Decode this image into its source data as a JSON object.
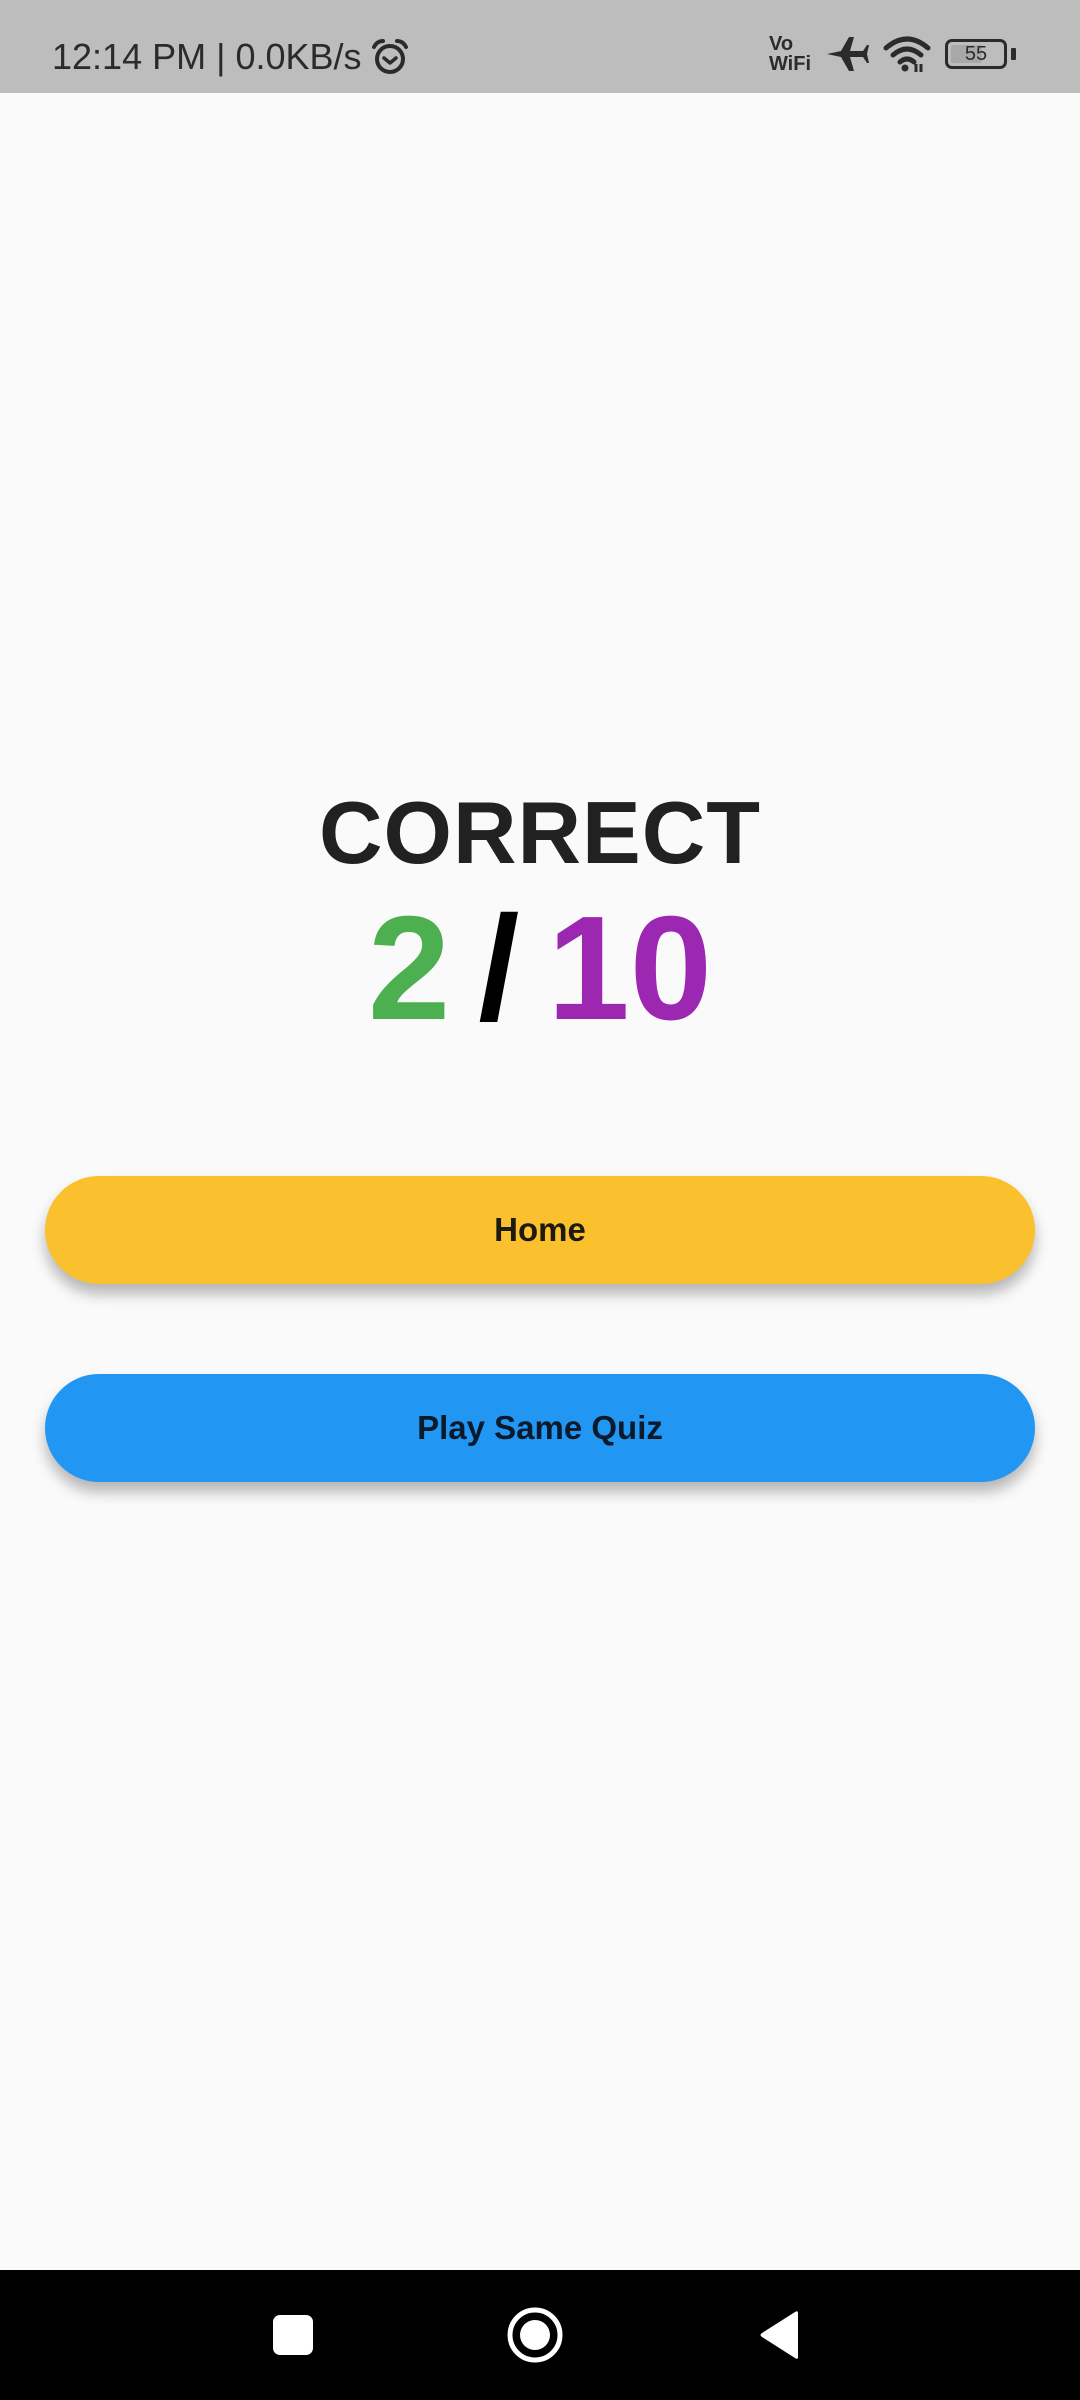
{
  "status_bar": {
    "time": "12:14 PM",
    "separator": "|",
    "network_speed": "0.0KB/s",
    "icons": [
      "alarm-icon",
      "vowifi-icon",
      "airplane-mode-icon",
      "wifi-icon",
      "battery-icon"
    ],
    "vowifi_top": "Vo",
    "vowifi_bottom": "WiFi",
    "battery_level": "55"
  },
  "result": {
    "title": "CORRECT",
    "correct_count": "2",
    "separator": "/",
    "total_count": "10",
    "colors": {
      "correct": "#4caf50",
      "total": "#9c27b0",
      "title": "#212121"
    }
  },
  "buttons": {
    "home_label": "Home",
    "home_color": "#fbc02d",
    "play_same_label": "Play Same Quiz",
    "play_same_color": "#2196f3"
  },
  "nav_bar": {
    "items": [
      "recent-apps",
      "home",
      "back"
    ]
  }
}
